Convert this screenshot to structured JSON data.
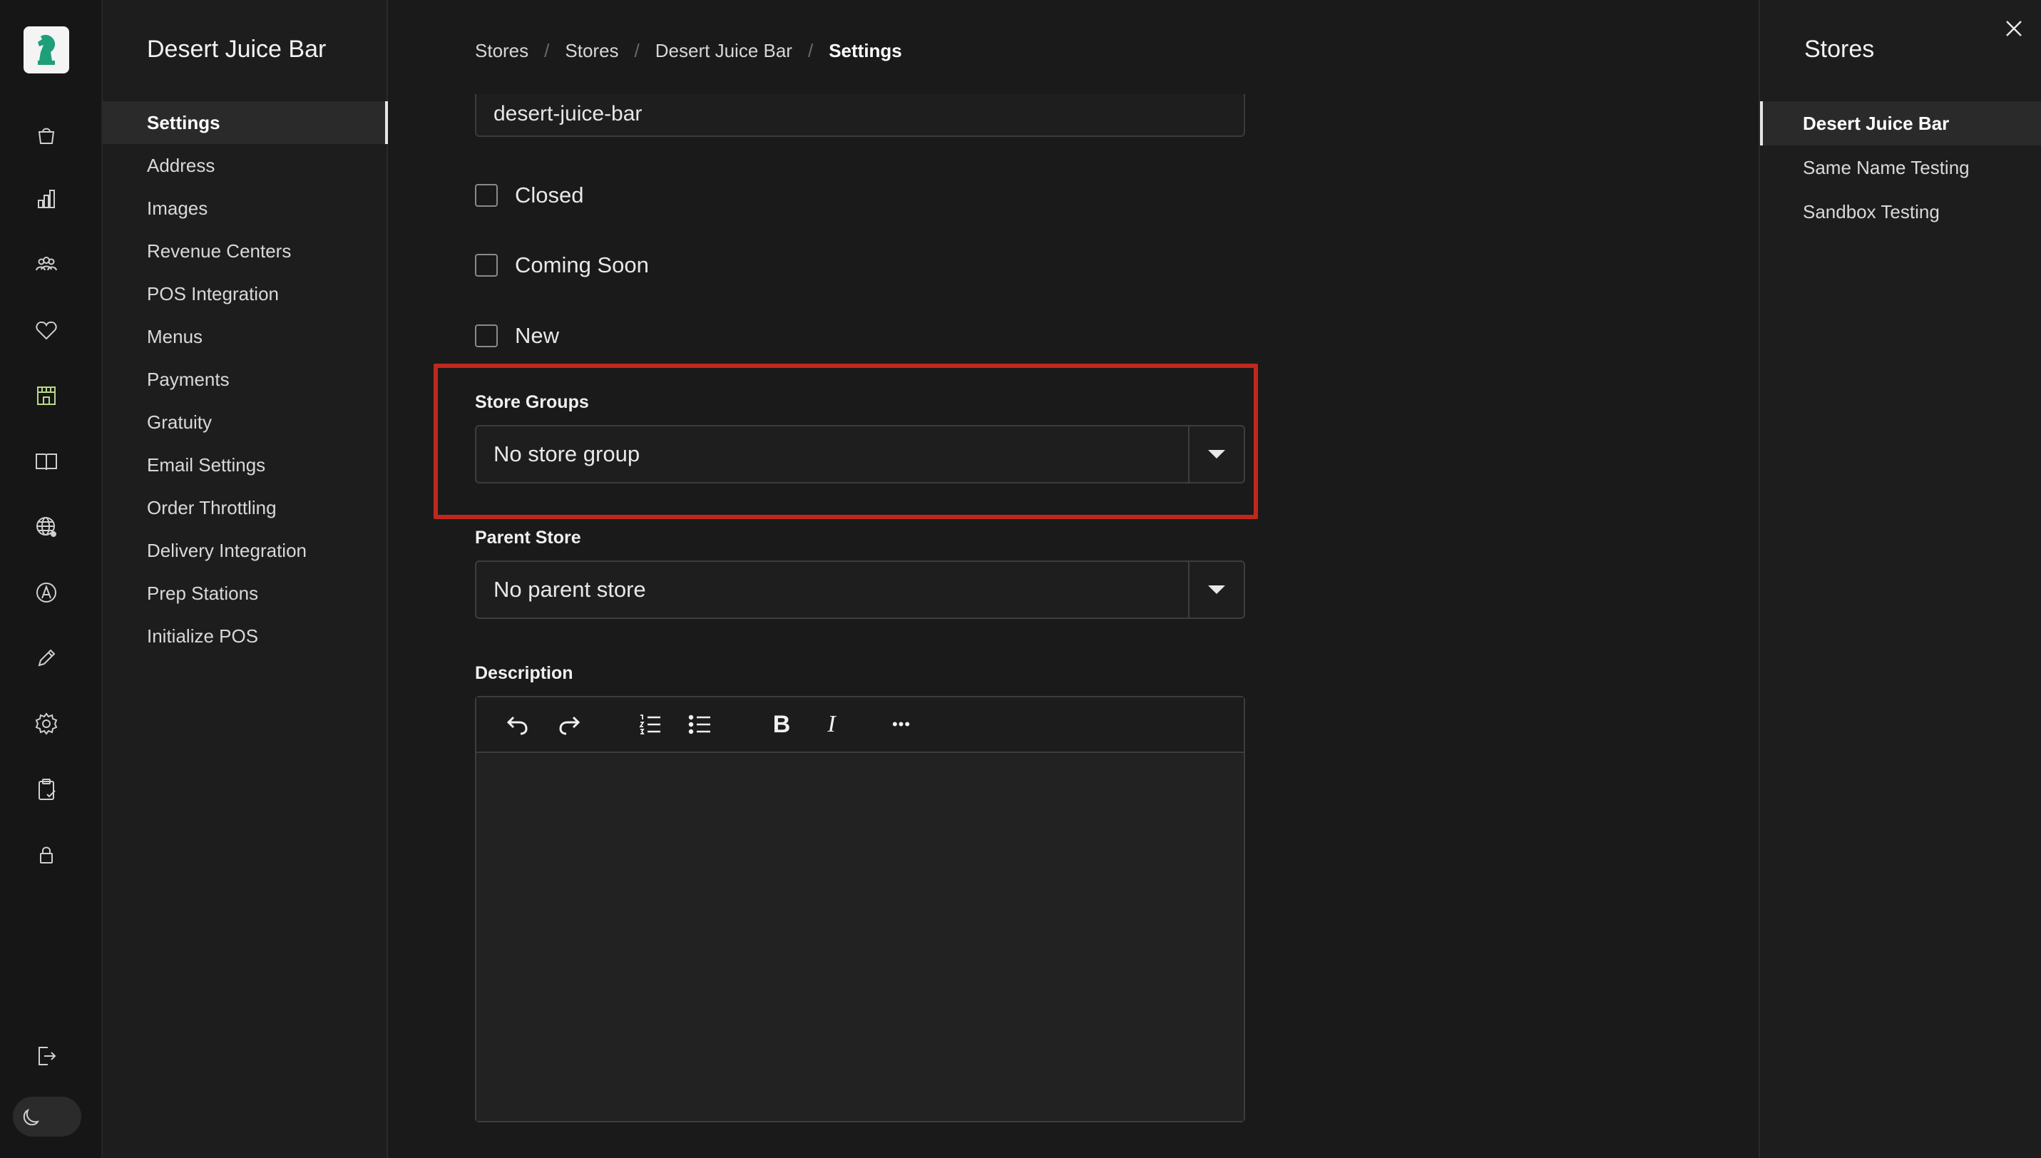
{
  "colors": {
    "accent_highlight": "#c0281c",
    "active_rail_icon": "#b9d98a",
    "logo_green": "#1f9e7a"
  },
  "rail": {
    "items": [
      {
        "name": "orders-bag-icon"
      },
      {
        "name": "reports-chart-icon"
      },
      {
        "name": "customers-icon"
      },
      {
        "name": "loyalty-heart-icon"
      },
      {
        "name": "stores-icon",
        "active": true
      },
      {
        "name": "menu-book-icon"
      },
      {
        "name": "web-globe-icon"
      },
      {
        "name": "brand-logo-icon"
      },
      {
        "name": "edit-pencil-icon"
      },
      {
        "name": "settings-gear-icon"
      },
      {
        "name": "reports-clipboard-icon"
      },
      {
        "name": "lock-icon"
      }
    ],
    "logout_icon": "logout-icon",
    "theme_icon": "moon-icon"
  },
  "sidebar": {
    "title": "Desert Juice Bar",
    "items": [
      {
        "label": "Settings",
        "active": true
      },
      {
        "label": "Address"
      },
      {
        "label": "Images"
      },
      {
        "label": "Revenue Centers"
      },
      {
        "label": "POS Integration"
      },
      {
        "label": "Menus"
      },
      {
        "label": "Payments"
      },
      {
        "label": "Gratuity"
      },
      {
        "label": "Email Settings"
      },
      {
        "label": "Order Throttling"
      },
      {
        "label": "Delivery Integration"
      },
      {
        "label": "Prep Stations"
      },
      {
        "label": "Initialize POS"
      }
    ]
  },
  "breadcrumb": {
    "items": [
      "Stores",
      "Stores",
      "Desert Juice Bar"
    ],
    "current": "Settings",
    "separator": "/"
  },
  "form": {
    "slug_value": "desert-juice-bar",
    "closed_label": "Closed",
    "closed_checked": false,
    "coming_soon_label": "Coming Soon",
    "coming_soon_checked": false,
    "new_label": "New",
    "new_checked": false,
    "store_groups_label": "Store Groups",
    "store_groups_value": "No store group",
    "parent_store_label": "Parent Store",
    "parent_store_value": "No parent store",
    "description_label": "Description",
    "toolbar": {
      "bold": "B",
      "italic": "I",
      "more": "•••"
    }
  },
  "right_panel": {
    "title": "Stores",
    "stores": [
      {
        "label": "Desert Juice Bar",
        "active": true
      },
      {
        "label": "Same Name Testing"
      },
      {
        "label": "Sandbox Testing"
      }
    ]
  }
}
